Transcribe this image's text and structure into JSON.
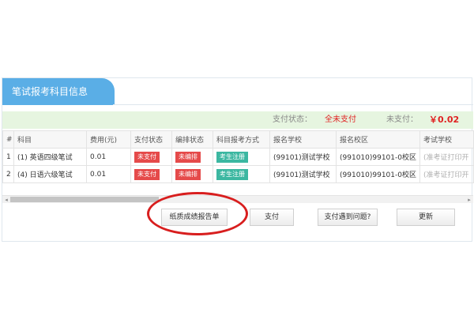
{
  "panel": {
    "title": "笔试报考科目信息"
  },
  "status": {
    "pay_status_label": "支付状态：",
    "pay_status_value": "全未支付",
    "unpaid_label": "未支付：",
    "unpaid_amount": "￥0.02"
  },
  "table": {
    "headers": [
      "#",
      "科目",
      "费用(元)",
      "支付状态",
      "编排状态",
      "科目报考方式",
      "报名学校",
      "报名校区",
      "考试学校"
    ],
    "rows": [
      {
        "index": "1",
        "subject": "(1) 英语四级笔试",
        "fee": "0.01",
        "pay_status": "未支付",
        "arrange_status": "未编排",
        "method": "考生注册",
        "school": "(99101)测试学校",
        "campus": "(991010)99101-0校区",
        "exam_school": "(准考证打印开"
      },
      {
        "index": "2",
        "subject": "(4) 日语六级笔试",
        "fee": "0.01",
        "pay_status": "未支付",
        "arrange_status": "未编排",
        "method": "考生注册",
        "school": "(99101)测试学校",
        "campus": "(991010)99101-0校区",
        "exam_school": "(准考证打印开"
      }
    ]
  },
  "scrollbar": {
    "left_arrow": "◂",
    "right_arrow": "▸"
  },
  "buttons": {
    "report": "纸质成绩报告单",
    "pay": "支付",
    "help": "支付遇到问题?",
    "refresh": "更新"
  },
  "colors": {
    "accent": "#5aaee6",
    "danger": "#e54a4a",
    "success": "#3cb7a1",
    "status_bg": "#e6f5e0",
    "highlight": "#d81e1e"
  }
}
